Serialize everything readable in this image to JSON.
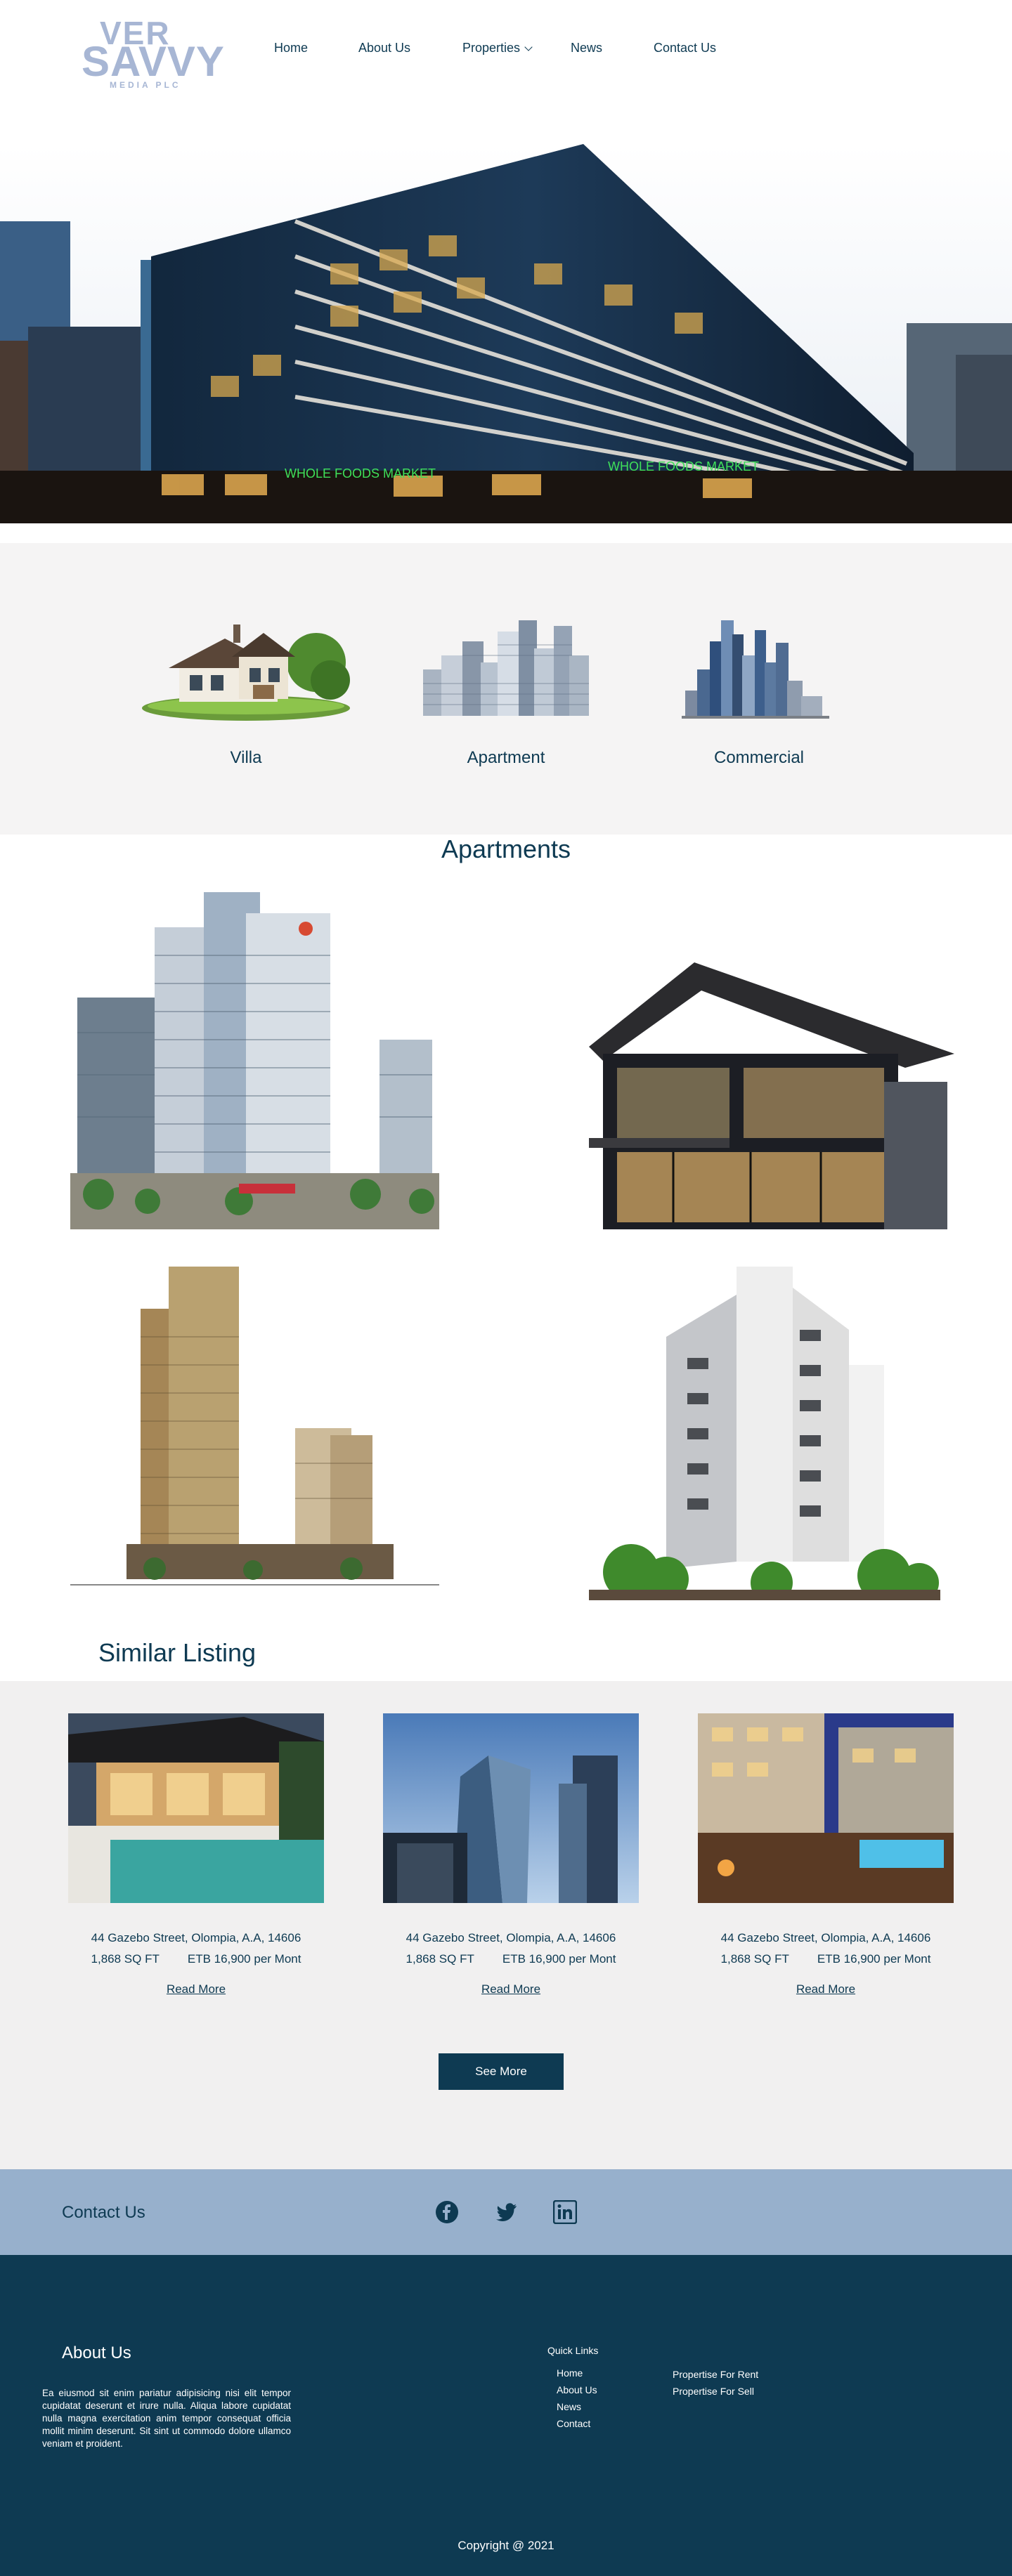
{
  "header": {
    "logo_line1": "VER",
    "logo_line2": "SAVVY",
    "logo_line3": "MEDIA PLC",
    "nav": [
      "Home",
      "About Us",
      "Properties",
      "News",
      "Contact Us"
    ]
  },
  "categories": [
    {
      "label": "Villa",
      "icon": "villa-house-image"
    },
    {
      "label": "Apartment",
      "icon": "apartment-towers-image"
    },
    {
      "label": "Commercial",
      "icon": "commercial-skyline-image"
    }
  ],
  "apartments": {
    "title": "Apartments"
  },
  "similar": {
    "title": "Similar Listing",
    "cards": [
      {
        "address": "44 Gazebo Street, Olompia, A.A, 14606",
        "area": "1,868 SQ FT",
        "price": "ETB  16,900 per Mont",
        "read_more": "Read More"
      },
      {
        "address": "44 Gazebo Street, Olompia, A.A, 14606",
        "area": "1,868 SQ FT",
        "price": "ETB  16,900 per Mont",
        "read_more": "Read More"
      },
      {
        "address": "44 Gazebo Street, Olompia, A.A, 14606",
        "area": "1,868 SQ FT",
        "price": "ETB  16,900 per Mont",
        "read_more": "Read More"
      }
    ],
    "see_more": "See More"
  },
  "contact": {
    "title": "Contact Us",
    "social_icons": [
      "facebook-icon",
      "twitter-icon",
      "linkedin-icon"
    ]
  },
  "footer": {
    "about_title": "About Us",
    "about_text": "Ea eiusmod sit enim pariatur adipisicing nisi elit tempor cupidatat deserunt et irure nulla. Aliqua labore cupidatat nulla magna exercitation anim tempor consequat officia mollit minim deserunt. Sit sint ut commodo dolore ullamco veniam et proident.",
    "quick_links_title": "Quick Links",
    "quick_links": [
      "Home",
      "About Us",
      "News",
      "Contact"
    ],
    "quick_links_2": [
      "Propertise For Rent",
      "Propertise For Sell"
    ],
    "copyright": "Copyright @ 2021"
  },
  "colors": {
    "primary": "#0e3a52",
    "logo": "#a7b6d4",
    "contact_bg": "#97b0cc",
    "section_bg": "#f5f4f4"
  }
}
